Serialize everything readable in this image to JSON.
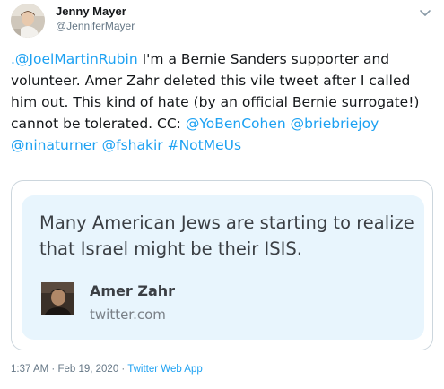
{
  "author": {
    "name": "Jenny Mayer",
    "handle": "@JenniferMayer"
  },
  "tweet": {
    "mention_1": ".@JoelMartinRubin",
    "text_1": " I'm a Bernie Sanders supporter and volunteer. Amer Zahr deleted this vile tweet after I called him out. This kind of hate (by an official Bernie surrogate!) cannot be tolerated. CC: ",
    "mention_2": "@YoBenCohen",
    "mention_3": "@briebriejoy",
    "mention_4": "@ninaturner",
    "mention_5": "@fshakir",
    "hashtag": "#NotMeUs"
  },
  "embedded_card": {
    "quote": "Many American Jews are starting to realize that Israel might be their ISIS.",
    "author_name": "Amer Zahr",
    "domain": "twitter.com"
  },
  "meta": {
    "time": "1:37 AM",
    "separator_1": " · ",
    "date": "Feb 19, 2020",
    "separator_2": " · ",
    "source": "Twitter Web App"
  },
  "icons": {
    "menu": "chevron-down-icon"
  },
  "colors": {
    "link": "#1da1f2",
    "card_background": "#e8f5fd",
    "text": "#14171a",
    "secondary_text": "#657786"
  }
}
